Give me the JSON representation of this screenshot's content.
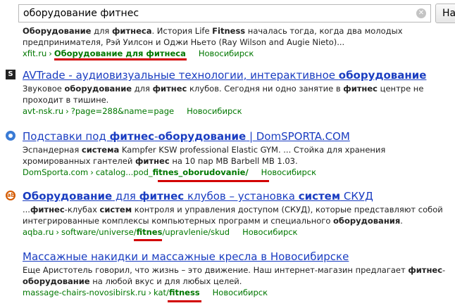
{
  "search": {
    "query": "оборудование фитнес",
    "clear_symbol": "✕",
    "button_label": "На"
  },
  "results": [
    {
      "title": "",
      "snippet_line1": [
        {
          "t": "Оборудование",
          "b": true
        },
        {
          "t": " для ",
          "b": false
        },
        {
          "t": "фитнеса",
          "b": true
        },
        {
          "t": ". История Life ",
          "b": false
        },
        {
          "t": "Fitness",
          "b": true
        },
        {
          "t": " началась тогда, когда два молодых",
          "b": false
        }
      ],
      "snippet_line2": [
        {
          "t": "предпринимателя, Рэй Уилсон и Оджи Ньето (Ray Wilson and Augie Nieto)...",
          "b": false
        }
      ],
      "url_domain": "xfit.ru",
      "url_path": "Оборудование для фитнеса",
      "region": "Новосибирск"
    },
    {
      "favicon": "S",
      "title_parts": [
        {
          "t": "AVTrade - аудиовизуальные технологии, интерактивное ",
          "b": false
        },
        {
          "t": "оборудование",
          "b": true
        }
      ],
      "snippet_line1": [
        {
          "t": "Звуковое ",
          "b": false
        },
        {
          "t": "оборудование",
          "b": true
        },
        {
          "t": " для ",
          "b": false
        },
        {
          "t": "фитнес",
          "b": true
        },
        {
          "t": " клубов. Сегодня ни одно занятие в ",
          "b": false
        },
        {
          "t": "фитнес",
          "b": true
        },
        {
          "t": " центре не",
          "b": false
        }
      ],
      "snippet_line2": [
        {
          "t": "проходит в тишине.",
          "b": false
        }
      ],
      "url_domain": "avt-nsk.ru",
      "url_path": "?page=288&name=page",
      "region": "Новосибирск"
    },
    {
      "title_parts": [
        {
          "t": "Подставки под ",
          "b": false
        },
        {
          "t": "фитнес",
          "b": true
        },
        {
          "t": "-",
          "b": false
        },
        {
          "t": "оборудование",
          "b": true
        },
        {
          "t": " | DomSPORTA.COM",
          "b": false
        }
      ],
      "snippet_line1": [
        {
          "t": "Эспандерная ",
          "b": false
        },
        {
          "t": "система",
          "b": true
        },
        {
          "t": " Kampfer KSW professional Elastic GYM. ... Стойка для хранения",
          "b": false
        }
      ],
      "snippet_line2": [
        {
          "t": "хромированных гантелей ",
          "b": false
        },
        {
          "t": "фитнес",
          "b": true
        },
        {
          "t": " на 10 пар MB Barbell MB 1.03.",
          "b": false
        }
      ],
      "url_domain": "DomSporta.com",
      "url_path_plain": "catalog...pod_",
      "url_path_bold": "fitnes_oborudovanie/",
      "region": "Новосибирск"
    },
    {
      "favicon": "ab",
      "title_parts": [
        {
          "t": "Оборудование",
          "b": true
        },
        {
          "t": " для ",
          "b": false
        },
        {
          "t": "фитнес",
          "b": true
        },
        {
          "t": " клубов – установка ",
          "b": false
        },
        {
          "t": "систем",
          "b": true
        },
        {
          "t": " СКУД",
          "b": false
        }
      ],
      "snippet_line1": [
        {
          "t": "...",
          "b": false
        },
        {
          "t": "фитнес",
          "b": true
        },
        {
          "t": "-клубах ",
          "b": false
        },
        {
          "t": "систем",
          "b": true
        },
        {
          "t": " контроля и управления доступом (СКУД), которые представляют собой",
          "b": false
        }
      ],
      "snippet_line2": [
        {
          "t": "интегрированные комплексы компьютерных программ и специального ",
          "b": false
        },
        {
          "t": "оборудования",
          "b": true
        },
        {
          "t": ".",
          "b": false
        }
      ],
      "url_domain": "aqba.ru",
      "url_path_plain": "software/universe/",
      "url_path_bold": "fitnes",
      "url_path_tail": "/upravlenie/skud",
      "region": "Новосибирск"
    },
    {
      "title_parts": [
        {
          "t": "Массажные накидки и массажные кресла в Новосибирске",
          "b": false
        }
      ],
      "snippet_line1": [
        {
          "t": "Еще Аристотель говорил, что жизнь – это движение. Наш интернет-магазин предлагает ",
          "b": false
        },
        {
          "t": "фитнес",
          "b": true
        },
        {
          "t": "-",
          "b": false
        }
      ],
      "snippet_line2": [
        {
          "t": "оборудование",
          "b": true
        },
        {
          "t": " на любой вкус и для любых целей.",
          "b": false
        }
      ],
      "url_domain": "massage-chairs-novosibirsk.ru",
      "url_path_plain": "kat/",
      "url_path_bold": "fitness",
      "region": "Новосибирск"
    }
  ],
  "url_separator": "›",
  "colors": {
    "link": "#1a3dc1",
    "url": "#007700",
    "underline_mark": "#d20000"
  }
}
